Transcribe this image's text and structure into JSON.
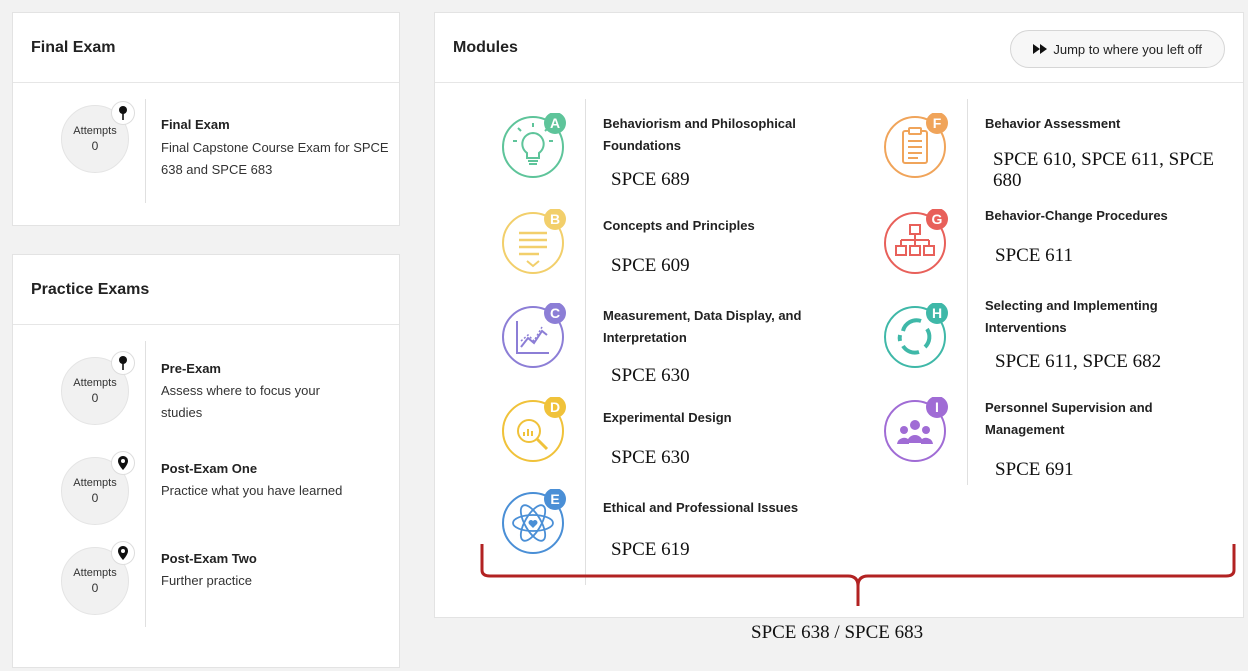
{
  "final_exam": {
    "header": "Final Exam",
    "item": {
      "attempts_label": "Attempts",
      "attempts_count": "0",
      "name": "Final Exam",
      "description": "Final Capstone Course Exam for SPCE 638 and SPCE 683"
    }
  },
  "practice_exams": {
    "header": "Practice Exams",
    "items": [
      {
        "attempts_label": "Attempts",
        "attempts_count": "0",
        "name": "Pre-Exam",
        "description": "Assess where to focus your studies"
      },
      {
        "attempts_label": "Attempts",
        "attempts_count": "0",
        "name": "Post-Exam One",
        "description": "Practice what you have learned"
      },
      {
        "attempts_label": "Attempts",
        "attempts_count": "0",
        "name": "Post-Exam Two",
        "description": "Further practice"
      }
    ]
  },
  "modules": {
    "header": "Modules",
    "jump_button": "Jump to where you left off",
    "items": [
      {
        "letter": "A",
        "title": "Behaviorism and Philosophical Foundations",
        "note": "SPCE 689",
        "color": "#5ec49a",
        "icon": "lightbulb-icon"
      },
      {
        "letter": "B",
        "title": "Concepts and Principles",
        "note": "SPCE 609",
        "color": "#f2cf6b",
        "icon": "text-lines-icon"
      },
      {
        "letter": "C",
        "title": "Measurement, Data Display, and Interpretation",
        "note": "SPCE 630",
        "color": "#8c7ed6",
        "icon": "line-chart-icon"
      },
      {
        "letter": "D",
        "title": "Experimental Design",
        "note": "SPCE 630",
        "color": "#f0c23a",
        "icon": "magnifier-chart-icon"
      },
      {
        "letter": "E",
        "title": "Ethical and Professional Issues",
        "note": "SPCE 619",
        "color": "#4a8fd6",
        "icon": "atom-heart-icon"
      },
      {
        "letter": "F",
        "title": "Behavior Assessment",
        "note": "SPCE 610, SPCE 611, SPCE 680",
        "color": "#f0a45a",
        "icon": "clipboard-icon"
      },
      {
        "letter": "G",
        "title": "Behavior-Change Procedures",
        "note": "SPCE 611",
        "color": "#e8605a",
        "icon": "org-chart-icon"
      },
      {
        "letter": "H",
        "title": "Selecting and Implementing Interventions",
        "note": "SPCE 611, SPCE 682",
        "color": "#3fb8a8",
        "icon": "cycle-arrows-icon"
      },
      {
        "letter": "I",
        "title": "Personnel Supervision and Management",
        "note": "SPCE 691",
        "color": "#a06cd5",
        "icon": "people-group-icon"
      }
    ]
  },
  "annotation": {
    "bracket_color": "#b22222",
    "label": "SPCE 638 / SPCE 683"
  }
}
